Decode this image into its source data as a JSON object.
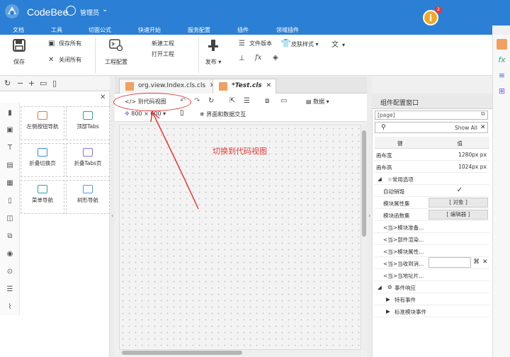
{
  "header": {
    "app_title": "CodeBee",
    "user_name": "管理员",
    "notification_count": "2"
  },
  "menu": [
    "文档",
    "工具",
    "切面公式",
    "快速开始",
    "服务配置",
    "插件",
    "领域插件"
  ],
  "ribbon": {
    "save": "保存",
    "save_all": "保存所有",
    "close_all": "关闭所有",
    "project_config": "工程配置",
    "new_project": "新建工程",
    "open_project": "打开工程",
    "publish": "发布",
    "file_version": "文件版本",
    "skin_style": "皮肤样式"
  },
  "left_panel": {
    "components": [
      {
        "label": "左侧按钮导航"
      },
      {
        "label": "顶部Tabs"
      },
      {
        "label": "折叠切换页"
      },
      {
        "label": "折叠Tabs页"
      },
      {
        "label": "菜单导航"
      },
      {
        "label": "树形导航"
      }
    ]
  },
  "tabs": [
    {
      "label": "org.view.Index.cls.cls",
      "active": false
    },
    {
      "label": "*Test.cls",
      "active": true
    }
  ],
  "editor_toolbar": {
    "to_code_view": "到代码视图",
    "data": "数据",
    "canvas_size": "800 × 600",
    "ui_data_interaction": "界面和数据交互"
  },
  "annotation": {
    "text": "切换到代码视图",
    "color": "#e53935"
  },
  "properties": {
    "title": "组件配置窗口",
    "selected": "[page]",
    "filter_show_all": "Show All",
    "col_key": "键",
    "col_value": "值",
    "rows": [
      {
        "key": "画布宽",
        "value": "1280px px"
      },
      {
        "key": "画布高",
        "value": "1024px px"
      }
    ],
    "section_common": "☆常用选项",
    "auto_destroy": "自动销毁",
    "module_props": "模块属性集",
    "module_props_value": "[ 对象 ]",
    "module_funcs": "模块函数集",
    "module_funcs_value": "[ 编辑器 ]",
    "events": [
      "<当>模块准备...",
      "<当>部件渲染...",
      "<当>模块属性...",
      "<当>当收到消...",
      "<当>当地址片..."
    ],
    "section_events": "事件响应",
    "specific_events": "特有事件",
    "standard_events": "标准模块事件"
  },
  "colors": {
    "header_blue": "#2b7fd4",
    "annotation_red": "#e53935"
  }
}
